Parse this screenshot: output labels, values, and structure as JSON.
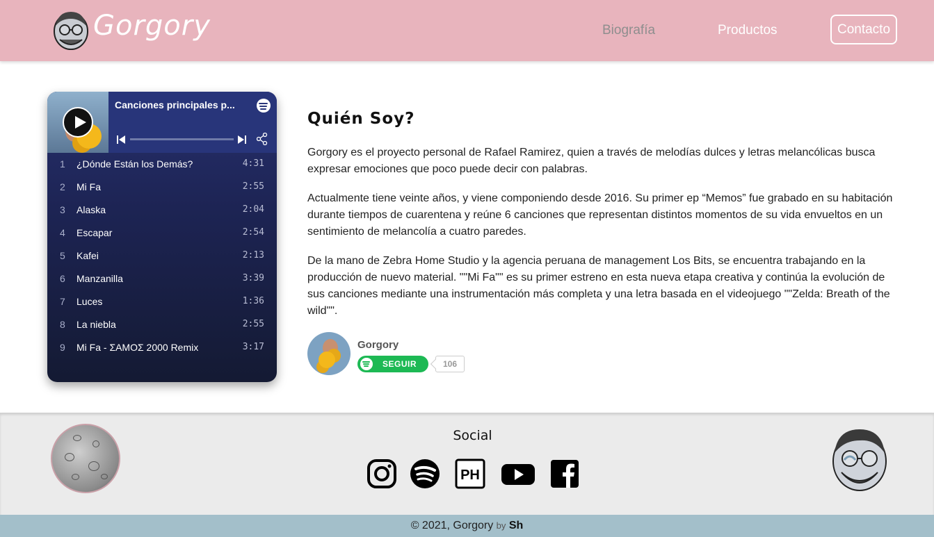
{
  "header": {
    "brand": "Gorgory",
    "nav": {
      "bio": "Biografía",
      "products": "Productos",
      "contact": "Contacto"
    }
  },
  "player": {
    "title": "Canciones principales p...",
    "tracks": [
      {
        "num": "1",
        "name": "¿Dónde Están los Demás?",
        "duration": "4:31"
      },
      {
        "num": "2",
        "name": "Mi Fa",
        "duration": "2:55"
      },
      {
        "num": "3",
        "name": "Alaska",
        "duration": "2:04"
      },
      {
        "num": "4",
        "name": "Escapar",
        "duration": "2:54"
      },
      {
        "num": "5",
        "name": "Kafei",
        "duration": "2:13"
      },
      {
        "num": "6",
        "name": "Manzanilla",
        "duration": "3:39"
      },
      {
        "num": "7",
        "name": "Luces",
        "duration": "1:36"
      },
      {
        "num": "8",
        "name": "La niebla",
        "duration": "2:55"
      },
      {
        "num": "9",
        "name": "Mi Fa - ΣΑΜΟΣ 2000 Remix",
        "duration": "3:17"
      }
    ]
  },
  "about": {
    "title": "Quién Soy?",
    "paragraphs": [
      "Gorgory es el proyecto personal de Rafael Ramirez, quien a través de melodías dulces y letras melancólicas busca expresar emociones que poco puede decir con palabras.",
      "Actualmente tiene veinte años, y viene componiendo desde 2016. Su primer ep “Memos” fue grabado en su habitación durante tiempos de cuarentena y reúne 6 canciones que representan distintos momentos de su vida envueltos en un sentimiento de melancolía a cuatro paredes.",
      "De la mano de Zebra Home Studio y la agencia peruana de management Los Bits, se encuentra trabajando en la producción de nuevo material. \"\"Mi Fa\"\" es su primer estreno en esta nueva etapa creativa y continúa la evolución de sus canciones mediante una instrumentación más completa y una letra basada en el videojuego \"\"Zelda: Breath of the wild\"\"."
    ],
    "artist": {
      "name": "Gorgory",
      "follow_label": "SEGUIR",
      "followers": "106"
    }
  },
  "footer": {
    "social_title": "Social",
    "social_icons": [
      "instagram-icon",
      "spotify-icon",
      "producthunt-icon",
      "youtube-icon",
      "facebook-icon"
    ],
    "copyright": "© 2021, Gorgory",
    "by": "by",
    "signature": "Sh"
  },
  "colors": {
    "header_bg": "#e8b4bd",
    "footer_bg": "#ebebeb",
    "copyright_bg": "#a3bfca",
    "spotify_green": "#1db954",
    "player_bg": "#1d2454"
  }
}
